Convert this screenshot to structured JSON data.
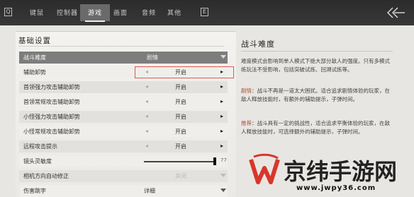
{
  "top_nav": {
    "left_badge": "Q",
    "tabs": [
      {
        "label": "键鼠"
      },
      {
        "label": "控制器"
      },
      {
        "label": "游戏",
        "active": true
      },
      {
        "label": "画面"
      },
      {
        "label": "音频"
      },
      {
        "label": "其他"
      }
    ],
    "right_badge": "E"
  },
  "settings": {
    "section_title": "基础设置",
    "rows": [
      {
        "label": "战斗难度",
        "value": "剧情",
        "type": "dropdown",
        "highlighted": true
      },
      {
        "label": "辅助卸势",
        "value": "开启",
        "type": "stepper"
      },
      {
        "label": "首领强力攻击辅助卸势",
        "value": "开启",
        "type": "stepper"
      },
      {
        "label": "首领常规攻击辅助卸势",
        "value": "开启",
        "type": "stepper"
      },
      {
        "label": "小怪强力攻击辅助卸势",
        "value": "开启",
        "type": "stepper"
      },
      {
        "label": "小怪常规攻击辅助卸势",
        "value": "开启",
        "type": "stepper"
      },
      {
        "label": "远程攻击提示",
        "value": "开启",
        "type": "stepper"
      },
      {
        "label": "镜头灵敏度",
        "value": "77",
        "type": "slider",
        "level": 0.77
      },
      {
        "label": "相机方向自动修正",
        "value": "关闭",
        "type": "dropdown",
        "disabled": true
      },
      {
        "label": "伤害跳字",
        "value": "详细",
        "type": "dropdown"
      }
    ]
  },
  "description": {
    "title": "战斗难度",
    "p1": "难度模式会影响到单人模式下绝大部分敌人的强度。只有多模式练玩法不受影响，包括突破试炼、回溯试炼等。",
    "p2_key": "剧情",
    "p2": "：战斗不再是一道太大困扰。适合追求剧情体验的玩家，在敌人释放技能时，有额外的辅助提示，子弹时间。",
    "p3_key": "推荐",
    "p3": "：战斗具有一定的挑战性，适合追求平衡体验的玩家，在敌人释放技能时，可选择额外的辅助提示，子弹时间。"
  },
  "watermark": {
    "text": "京纬手游网",
    "url": "www.jwpy36.com"
  },
  "colors": {
    "topbar": "#2c2c2c",
    "accent_red": "#e0584f",
    "highlight_text": "#b64a3b",
    "header_row": "#7d7d7d"
  }
}
